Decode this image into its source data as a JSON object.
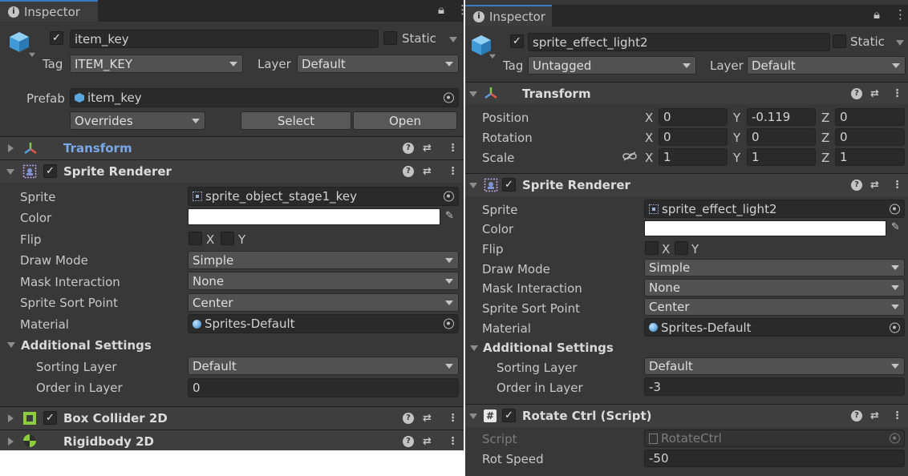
{
  "left": {
    "tab_label": "Inspector",
    "object": {
      "active": true,
      "name": "item_key",
      "static_label": "Static",
      "static_checked": false
    },
    "tag": {
      "label": "Tag",
      "value": "ITEM_KEY"
    },
    "layer": {
      "label": "Layer",
      "value": "Default"
    },
    "prefab": {
      "label": "Prefab",
      "value": "item_key",
      "overrides": "Overrides",
      "select": "Select",
      "open": "Open"
    },
    "components": {
      "transform": {
        "title": "Transform",
        "expanded": false
      },
      "sprite_renderer": {
        "title": "Sprite Renderer",
        "enabled": true,
        "rows": {
          "sprite": {
            "label": "Sprite",
            "value": "sprite_object_stage1_key"
          },
          "color": {
            "label": "Color",
            "value": "#ffffff"
          },
          "flip": {
            "label": "Flip",
            "x": "X",
            "y": "Y",
            "x_checked": false,
            "y_checked": false
          },
          "draw_mode": {
            "label": "Draw Mode",
            "value": "Simple"
          },
          "mask_interaction": {
            "label": "Mask Interaction",
            "value": "None"
          },
          "sprite_sort_point": {
            "label": "Sprite Sort Point",
            "value": "Center"
          },
          "material": {
            "label": "Material",
            "value": "Sprites-Default"
          }
        },
        "additional": {
          "title": "Additional Settings",
          "sorting_layer_label": "Sorting Layer",
          "sorting_layer_value": "Default",
          "order_label": "Order in Layer",
          "order_value": "0"
        }
      },
      "box_collider": {
        "title": "Box Collider 2D",
        "enabled": true
      },
      "rigidbody": {
        "title": "Rigidbody 2D"
      }
    }
  },
  "right": {
    "tab_label": "Inspector",
    "object": {
      "active": true,
      "name": "sprite_effect_light2",
      "static_label": "Static",
      "static_checked": false
    },
    "tag": {
      "label": "Tag",
      "value": "Untagged"
    },
    "layer": {
      "label": "Layer",
      "value": "Default"
    },
    "transform": {
      "title": "Transform",
      "position": {
        "label": "Position",
        "x": "0",
        "y": "-0.119",
        "z": "0"
      },
      "rotation": {
        "label": "Rotation",
        "x": "0",
        "y": "0",
        "z": "0"
      },
      "scale": {
        "label": "Scale",
        "x": "1",
        "y": "1",
        "z": "1"
      },
      "axis": {
        "x": "X",
        "y": "Y",
        "z": "Z"
      }
    },
    "sprite_renderer": {
      "title": "Sprite Renderer",
      "enabled": true,
      "rows": {
        "sprite": {
          "label": "Sprite",
          "value": "sprite_effect_light2"
        },
        "color": {
          "label": "Color",
          "value": "#ffffff"
        },
        "flip": {
          "label": "Flip",
          "x": "X",
          "y": "Y"
        },
        "draw_mode": {
          "label": "Draw Mode",
          "value": "Simple"
        },
        "mask_interaction": {
          "label": "Mask Interaction",
          "value": "None"
        },
        "sprite_sort_point": {
          "label": "Sprite Sort Point",
          "value": "Center"
        },
        "material": {
          "label": "Material",
          "value": "Sprites-Default"
        }
      },
      "additional": {
        "title": "Additional Settings",
        "sorting_layer_label": "Sorting Layer",
        "sorting_layer_value": "Default",
        "order_label": "Order in Layer",
        "order_value": "-3"
      }
    },
    "rotate_ctrl": {
      "title": "Rotate Ctrl (Script)",
      "enabled": true,
      "script_label": "Script",
      "script_value": "RotateCtrl",
      "rot_speed_label": "Rot Speed",
      "rot_speed_value": "-50"
    }
  },
  "icons": {
    "lock": "lock-icon",
    "menu": "kebab-menu-icon",
    "help": "help-icon",
    "presets": "presets-icon",
    "gameobject": "gameobject-cube-icon"
  }
}
